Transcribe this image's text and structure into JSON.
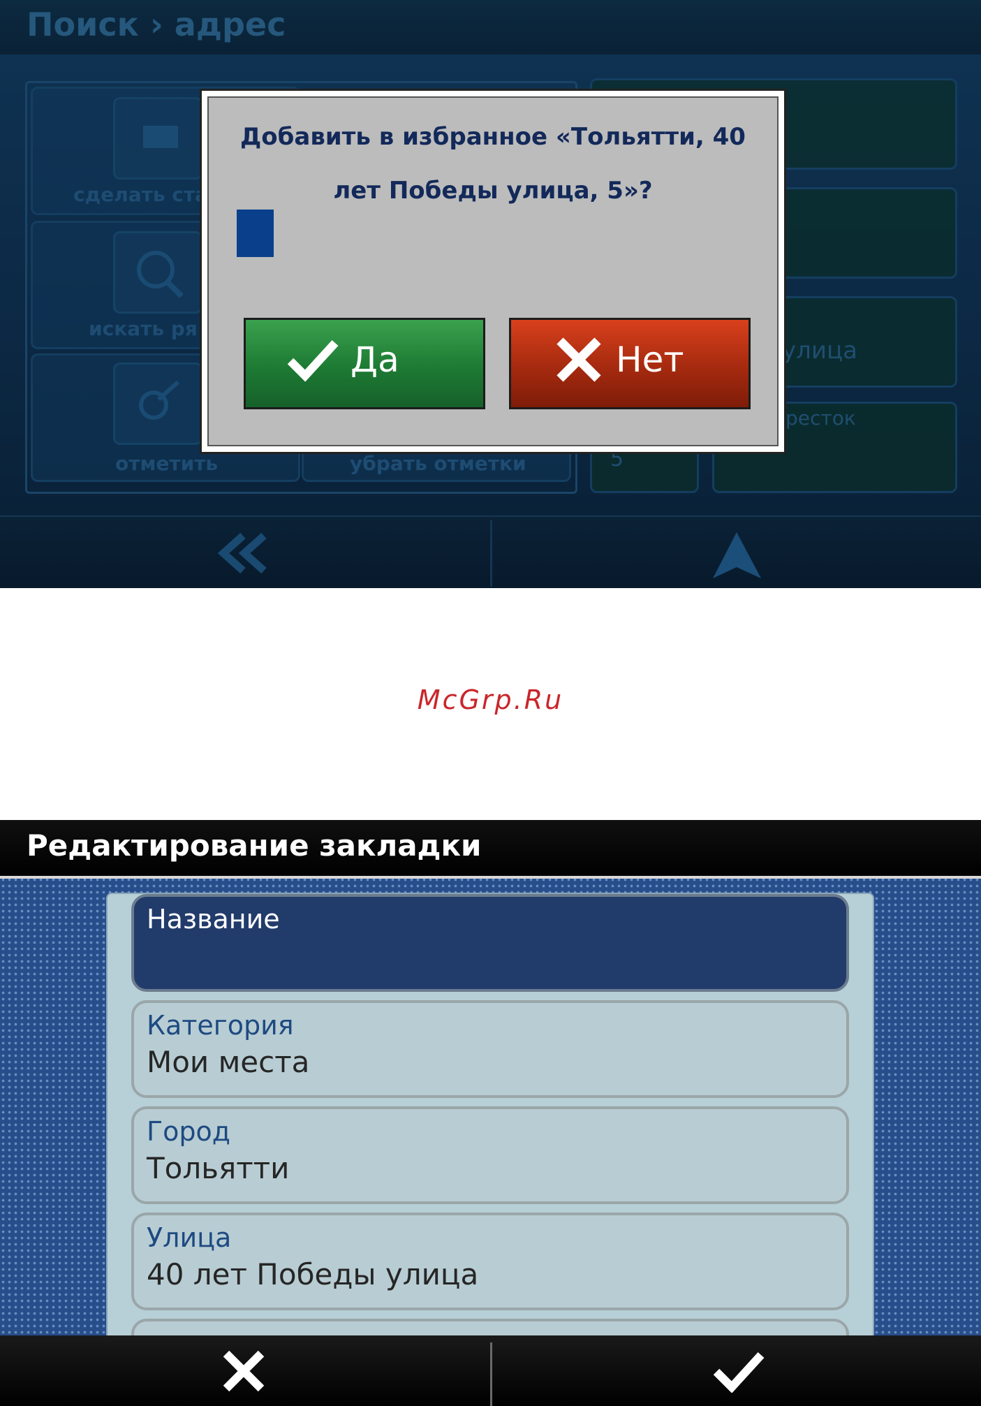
{
  "screen1": {
    "header_title": "Поиск › адрес",
    "bg_buttons": {
      "make_start": "сделать ста",
      "search_nearby": "искать ря",
      "mark": "отметить",
      "remove_marks": "убрать отметки"
    },
    "bg_fields": {
      "house_number": "5",
      "street_fragment": "улица",
      "crossroad_fragment": "ресток"
    },
    "dialog": {
      "question": "Добавить в избранное «Тольятти, 40 лет Победы улица, 5»?",
      "yes_label": "Да",
      "no_label": "Нет"
    }
  },
  "watermark": "McGrp.Ru",
  "screen2": {
    "header_title": "Редактирование закладки",
    "items": [
      {
        "label": "Название",
        "value": ""
      },
      {
        "label": "Категория",
        "value": "Мои места"
      },
      {
        "label": "Город",
        "value": "Тольятти"
      },
      {
        "label": "Улица",
        "value": "40 лет Победы улица"
      }
    ]
  },
  "colors": {
    "yes_button": "#1d7a33",
    "no_button": "#a52a0f",
    "dialog_text": "#13295a",
    "selected_item": "#213b6b",
    "item_label": "#1e4a82"
  }
}
